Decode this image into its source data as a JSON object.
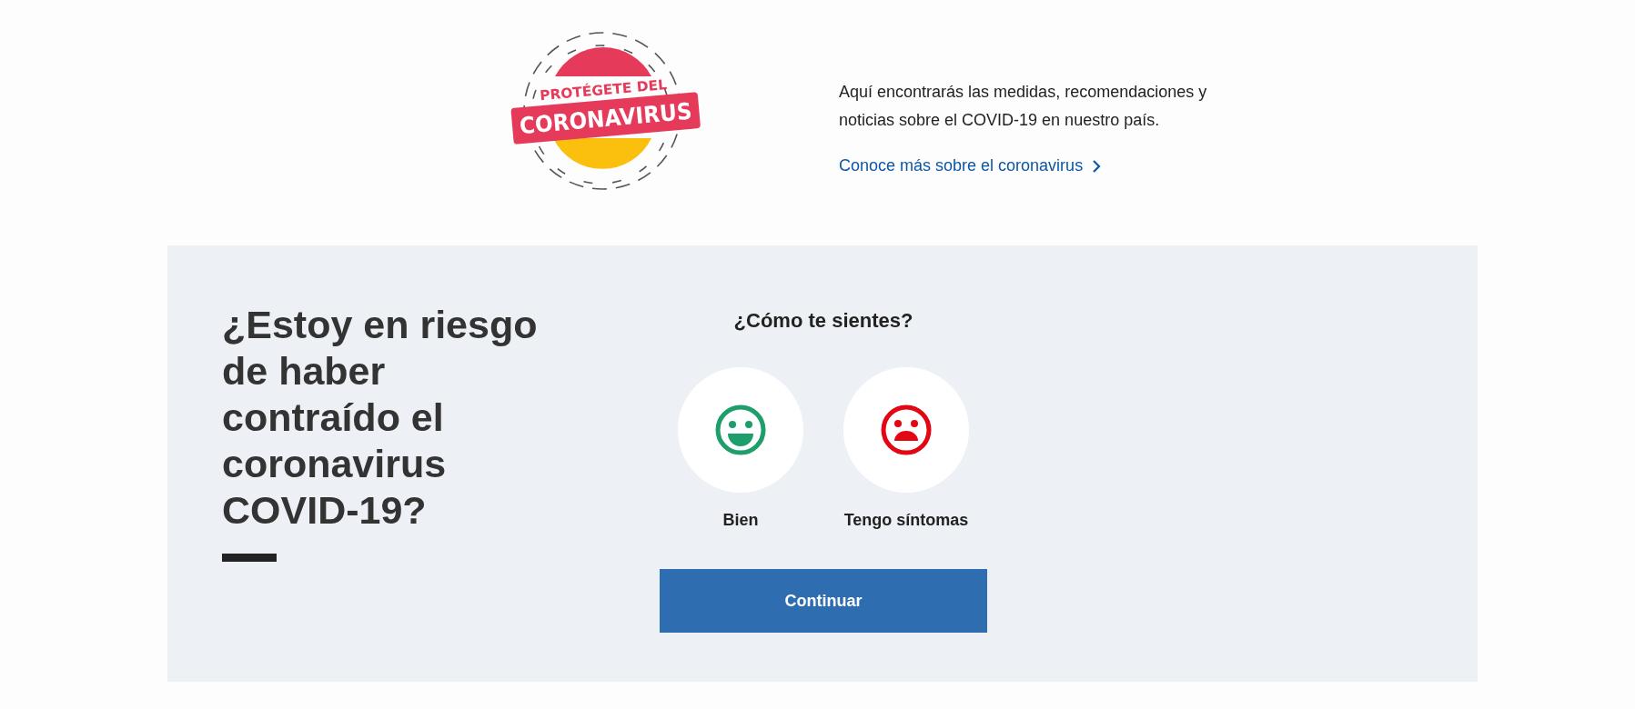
{
  "banner": {
    "logo": {
      "line_1": "PROTÉGETE DEL",
      "line_2": "CORONAVIRUS"
    },
    "intro": "Aquí encontrarás las medidas, recomendaciones y noticias sobre el COVID-19 en nuestro país.",
    "link": "Conoce más sobre el coronavirus"
  },
  "check": {
    "title": "¿Estoy en riesgo de haber contraído el coronavirus COVID-19?",
    "question": "¿Cómo te sientes?",
    "options": [
      {
        "label": "Bien",
        "kind": "happy",
        "color": "#1e9e6a"
      },
      {
        "label": "Tengo síntomas",
        "kind": "sad",
        "color": "#e30613"
      }
    ],
    "button": "Continuar"
  }
}
